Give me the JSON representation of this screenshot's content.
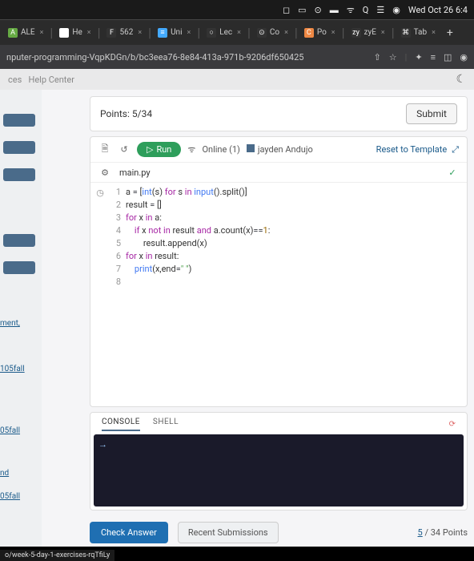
{
  "menubar": {
    "datetime": "Wed Oct 26 6:4"
  },
  "tabs": [
    {
      "icon": "A",
      "iconBg": "#6a4",
      "label": "ALE",
      "close": "×"
    },
    {
      "icon": "G",
      "iconBg": "#fff",
      "label": "He",
      "close": "×"
    },
    {
      "icon": "F",
      "iconBg": "#333",
      "label": "562",
      "close": "×"
    },
    {
      "icon": "≡",
      "iconBg": "#4af",
      "label": "Uni",
      "close": "×"
    },
    {
      "icon": "○",
      "iconBg": "#333",
      "label": "Lec",
      "close": "×"
    },
    {
      "icon": "⊙",
      "iconBg": "#333",
      "label": "Co",
      "close": "×"
    },
    {
      "icon": "C",
      "iconBg": "#e84",
      "label": "Po",
      "close": "×"
    },
    {
      "icon": "zy",
      "iconBg": "#333",
      "label": "zyE",
      "close": "×"
    },
    {
      "icon": "⌘",
      "iconBg": "#333",
      "label": "Tab",
      "close": "×"
    }
  ],
  "url": "nputer-programming-VqpKDGn/b/bc3eea76-8e84-413a-971b-9206df650425",
  "breadcrumb": {
    "left1": "ces",
    "left2": "Help Center"
  },
  "sidebar": {
    "items": [
      "ment,",
      "105fall",
      "05fall",
      "nd",
      "05fall"
    ]
  },
  "points": {
    "label": "Points: 5/34",
    "submit": "Submit"
  },
  "editor": {
    "run": "Run",
    "online": "Online (1)",
    "user": "jayden Andujo",
    "reset": "Reset to Template",
    "filename": "main.py",
    "lines": [
      {
        "n": "1",
        "html": "a <span class='op'>=</span> [<span class='fn'>int</span>(s) <span class='kw'>for</span> s <span class='kw'>in</span> <span class='fn'>input</span>().split()]"
      },
      {
        "n": "2",
        "html": "result <span class='op'>=</span> []"
      },
      {
        "n": "3",
        "html": "<span class='kw'>for</span> x <span class='kw'>in</span> a:"
      },
      {
        "n": "4",
        "html": "    <span class='kw'>if</span> x <span class='kw'>not in</span> result <span class='kw'>and</span> a.count(x)<span class='op'>==</span><span class='num'>1</span>:"
      },
      {
        "n": "5",
        "html": "        result.append(x)"
      },
      {
        "n": "6",
        "html": "<span class='kw'>for</span> x <span class='kw'>in</span> result:"
      },
      {
        "n": "7",
        "html": "    <span class='fn'>print</span>(x,end<span class='op'>=</span><span class='str'>\" \"</span>)"
      },
      {
        "n": "8",
        "html": ""
      }
    ]
  },
  "console": {
    "tab1": "CONSOLE",
    "tab2": "SHELL",
    "prompt": "→"
  },
  "bottom": {
    "check": "Check Answer",
    "recent": "Recent Submissions",
    "scoreNum": "5",
    "scoreTotal": " / 34 Points"
  },
  "footer": "o/week-5-day-1-exercises-rqTfiLy"
}
